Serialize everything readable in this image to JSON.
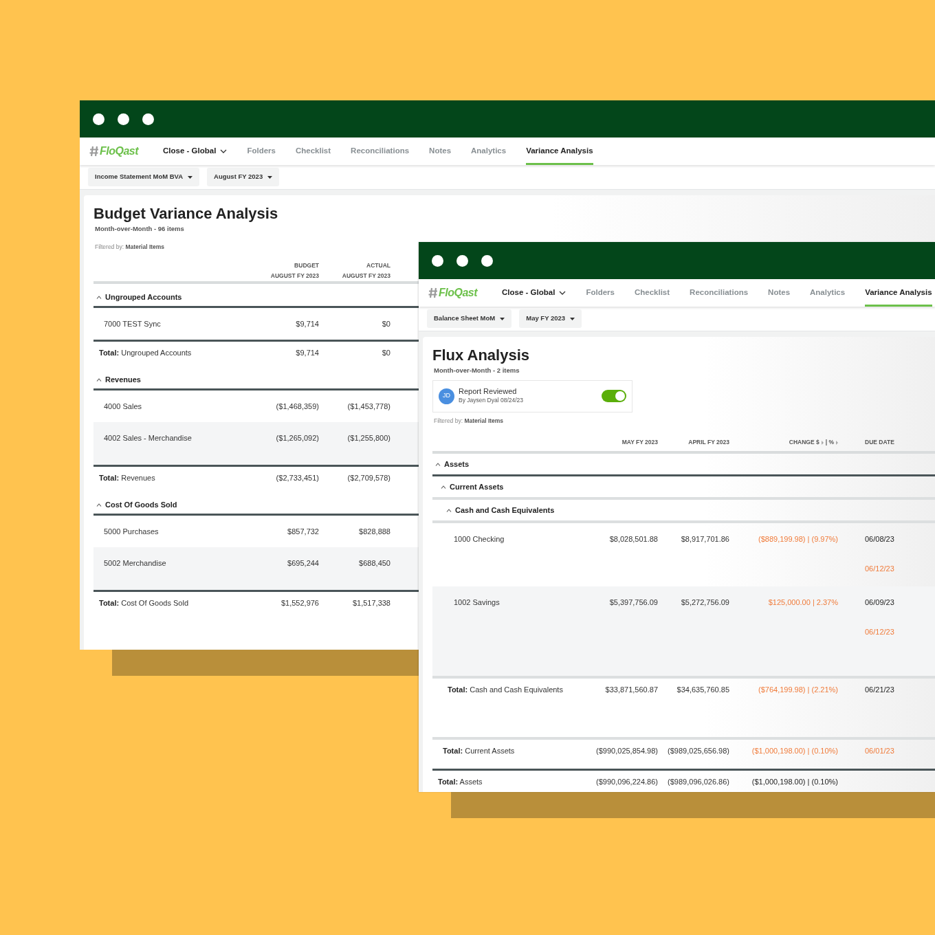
{
  "windows": [
    {
      "logo": "FloQast",
      "nav": [
        {
          "label": "Close - Global",
          "kind": "dropdown",
          "selected": false
        },
        {
          "label": "Folders",
          "kind": "link",
          "selected": false
        },
        {
          "label": "Checklist",
          "kind": "link",
          "selected": false
        },
        {
          "label": "Reconciliations",
          "kind": "link",
          "selected": false
        },
        {
          "label": "Notes",
          "kind": "link",
          "selected": false
        },
        {
          "label": "Analytics",
          "kind": "link",
          "selected": false
        },
        {
          "label": "Variance Analysis",
          "kind": "link",
          "selected": true
        }
      ],
      "filters": [
        "Income Statement MoM BVA",
        "August FY 2023"
      ],
      "title": "Budget Variance Analysis",
      "subtitle": "Month-over-Month - 96 items",
      "filtered": "Filtered by: **Material Items**",
      "columns": [
        {
          "label": "BUDGET",
          "sublabel": "AUGUST FY 2023"
        },
        {
          "label": "ACTUAL",
          "sublabel": "AUGUST FY 2023"
        }
      ],
      "rows": [
        {
          "kind": "group",
          "label": "Ungrouped Accounts",
          "expanded": true,
          "children": [
            {
              "kind": "account",
              "label": "7000 TEST Sync",
              "values": [
                "$9,714",
                "$0"
              ],
              "shaded": false
            }
          ],
          "total": {
            "label": "**Total:** Ungrouped Accounts",
            "values": [
              "$9,714",
              "$0"
            ]
          }
        },
        {
          "kind": "group",
          "label": "Revenues",
          "expanded": true,
          "children": [
            {
              "kind": "account",
              "label": "4000 Sales",
              "values": [
                "($1,468,359)",
                "($1,453,778)"
              ],
              "shaded": false
            },
            {
              "kind": "account",
              "label": "4002 Sales - Merchandise",
              "values": [
                "($1,265,092)",
                "($1,255,800)"
              ],
              "shaded": true
            }
          ],
          "total": {
            "label": "**Total:** Revenues",
            "values": [
              "($2,733,451)",
              "($2,709,578)"
            ]
          }
        },
        {
          "kind": "group",
          "label": "Cost Of Goods Sold",
          "expanded": true,
          "children": [
            {
              "kind": "account",
              "label": "5000 Purchases",
              "values": [
                "$857,732",
                "$828,888"
              ],
              "shaded": false
            },
            {
              "kind": "account",
              "label": "5002 Merchandise",
              "values": [
                "$695,244",
                "$688,450"
              ],
              "shaded": true
            }
          ],
          "total": {
            "label": "**Total:** Cost Of Goods Sold",
            "values": [
              "$1,552,976",
              "$1,517,338"
            ]
          }
        }
      ]
    },
    {
      "logo": "FloQast",
      "nav": [
        {
          "label": "Close - Global",
          "kind": "dropdown",
          "selected": false
        },
        {
          "label": "Folders",
          "kind": "link",
          "selected": false
        },
        {
          "label": "Checklist",
          "kind": "link",
          "selected": false
        },
        {
          "label": "Reconciliations",
          "kind": "link",
          "selected": false
        },
        {
          "label": "Notes",
          "kind": "link",
          "selected": false
        },
        {
          "label": "Analytics",
          "kind": "link",
          "selected": false
        },
        {
          "label": "Variance Analysis",
          "kind": "link",
          "selected": true
        }
      ],
      "filters": [
        "Balance Sheet MoM",
        "May FY 2023"
      ],
      "title": "Flux Analysis",
      "subtitle": "Month-over-Month - 2 items",
      "review": {
        "initials": "JD",
        "label": "Report Reviewed",
        "by": "By Jaysen Dyal 08/24/23",
        "on": true
      },
      "filtered": "Filtered by: **Material Items**",
      "columns": [
        {
          "label": "MAY FY 2023"
        },
        {
          "label": "APRIL FY 2023"
        },
        {
          "label": "CHANGE $",
          "label_2": "| %",
          "sort_carets": true
        },
        {
          "label": "DUE DATE"
        }
      ],
      "rows": [
        {
          "kind": "group",
          "label": "Assets",
          "expanded": true,
          "children": [
            {
              "kind": "group",
              "label": "Current Assets",
              "expanded": true,
              "children": [
                {
                  "kind": "group",
                  "label": "Cash and Cash Equivalents",
                  "expanded": true,
                  "children": [
                    {
                      "kind": "account",
                      "label": "1000 Checking",
                      "values": [
                        "$8,028,501.88",
                        "$8,917,701.86"
                      ],
                      "change": {
                        "text": "($889,199.98) | (9.97%)",
                        "flagged": true
                      },
                      "due_dates": [
                        {
                          "date": "06/08/23",
                          "flagged": false
                        },
                        {
                          "date": "06/12/23",
                          "flagged": true
                        }
                      ],
                      "shaded": false
                    },
                    {
                      "kind": "account",
                      "label": "1002 Savings",
                      "values": [
                        "$5,397,756.09",
                        "$5,272,756.09"
                      ],
                      "change": {
                        "text": "$125,000.00 | 2.37%",
                        "flagged": true
                      },
                      "due_dates": [
                        {
                          "date": "06/09/23",
                          "flagged": false
                        },
                        {
                          "date": "06/12/23",
                          "flagged": true
                        }
                      ],
                      "shaded": true
                    }
                  ],
                  "total": {
                    "label": "**Total:** Cash and Cash Equivalents",
                    "values": [
                      "$33,871,560.87",
                      "$34,635,760.85"
                    ],
                    "change": {
                      "text": "($764,199.98) | (2.21%)",
                      "flagged": true
                    },
                    "due_dates": [
                      {
                        "date": "06/21/23",
                        "flagged": false
                      }
                    ]
                  }
                }
              ],
              "total": {
                "label": "**Total:** Current Assets",
                "values": [
                  "($990,025,854.98)",
                  "($989,025,656.98)"
                ],
                "change": {
                  "text": "($1,000,198.00) | (0.10%)",
                  "flagged": true
                },
                "due_dates": [
                  {
                    "date": "06/01/23",
                    "flagged": true
                  }
                ]
              }
            }
          ],
          "total": {
            "label": "**Total:** Assets",
            "values": [
              "($990,096,224.86)",
              "($989,096,026.86)"
            ],
            "change": {
              "text": "($1,000,198.00) | (0.10%)",
              "flagged": false
            }
          }
        }
      ]
    }
  ]
}
